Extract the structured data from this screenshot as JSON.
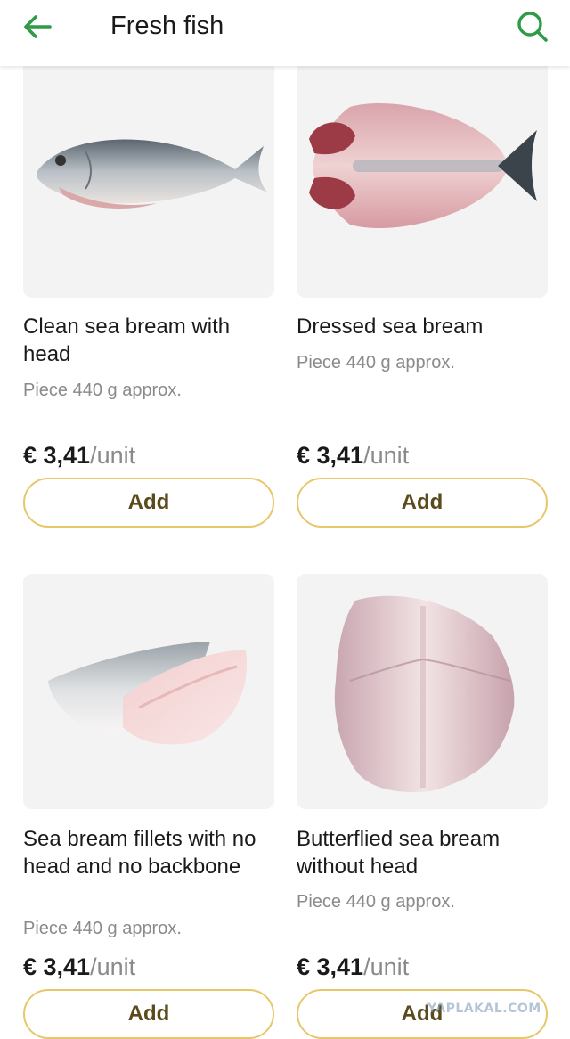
{
  "header": {
    "title": "Fresh fish",
    "back_icon": "arrow-left-icon",
    "search_icon": "search-icon",
    "accent_color": "#2e9b47"
  },
  "products": [
    {
      "name": "Clean sea bream with head",
      "weight": "Piece 440 g approx.",
      "price": "€ 3,41",
      "unit": "/unit",
      "add_label": "Add",
      "image_icon": "whole-fish-image"
    },
    {
      "name": "Dressed sea bream",
      "weight": "Piece 440 g approx.",
      "price": "€ 3,41",
      "unit": "/unit",
      "add_label": "Add",
      "image_icon": "dressed-fish-image"
    },
    {
      "name": "Sea bream fillets with no head and no backbone",
      "weight": "Piece 440 g approx.",
      "price": "€ 3,41",
      "unit": "/unit",
      "add_label": "Add",
      "image_icon": "fish-fillets-image"
    },
    {
      "name": "Butterflied sea bream without head",
      "weight": "Piece 440 g approx.",
      "price": "€ 3,41",
      "unit": "/unit",
      "add_label": "Add",
      "image_icon": "butterflied-fish-image"
    }
  ],
  "button_border_color": "#e8c66a",
  "watermark": "YAPLAKAL.COM"
}
